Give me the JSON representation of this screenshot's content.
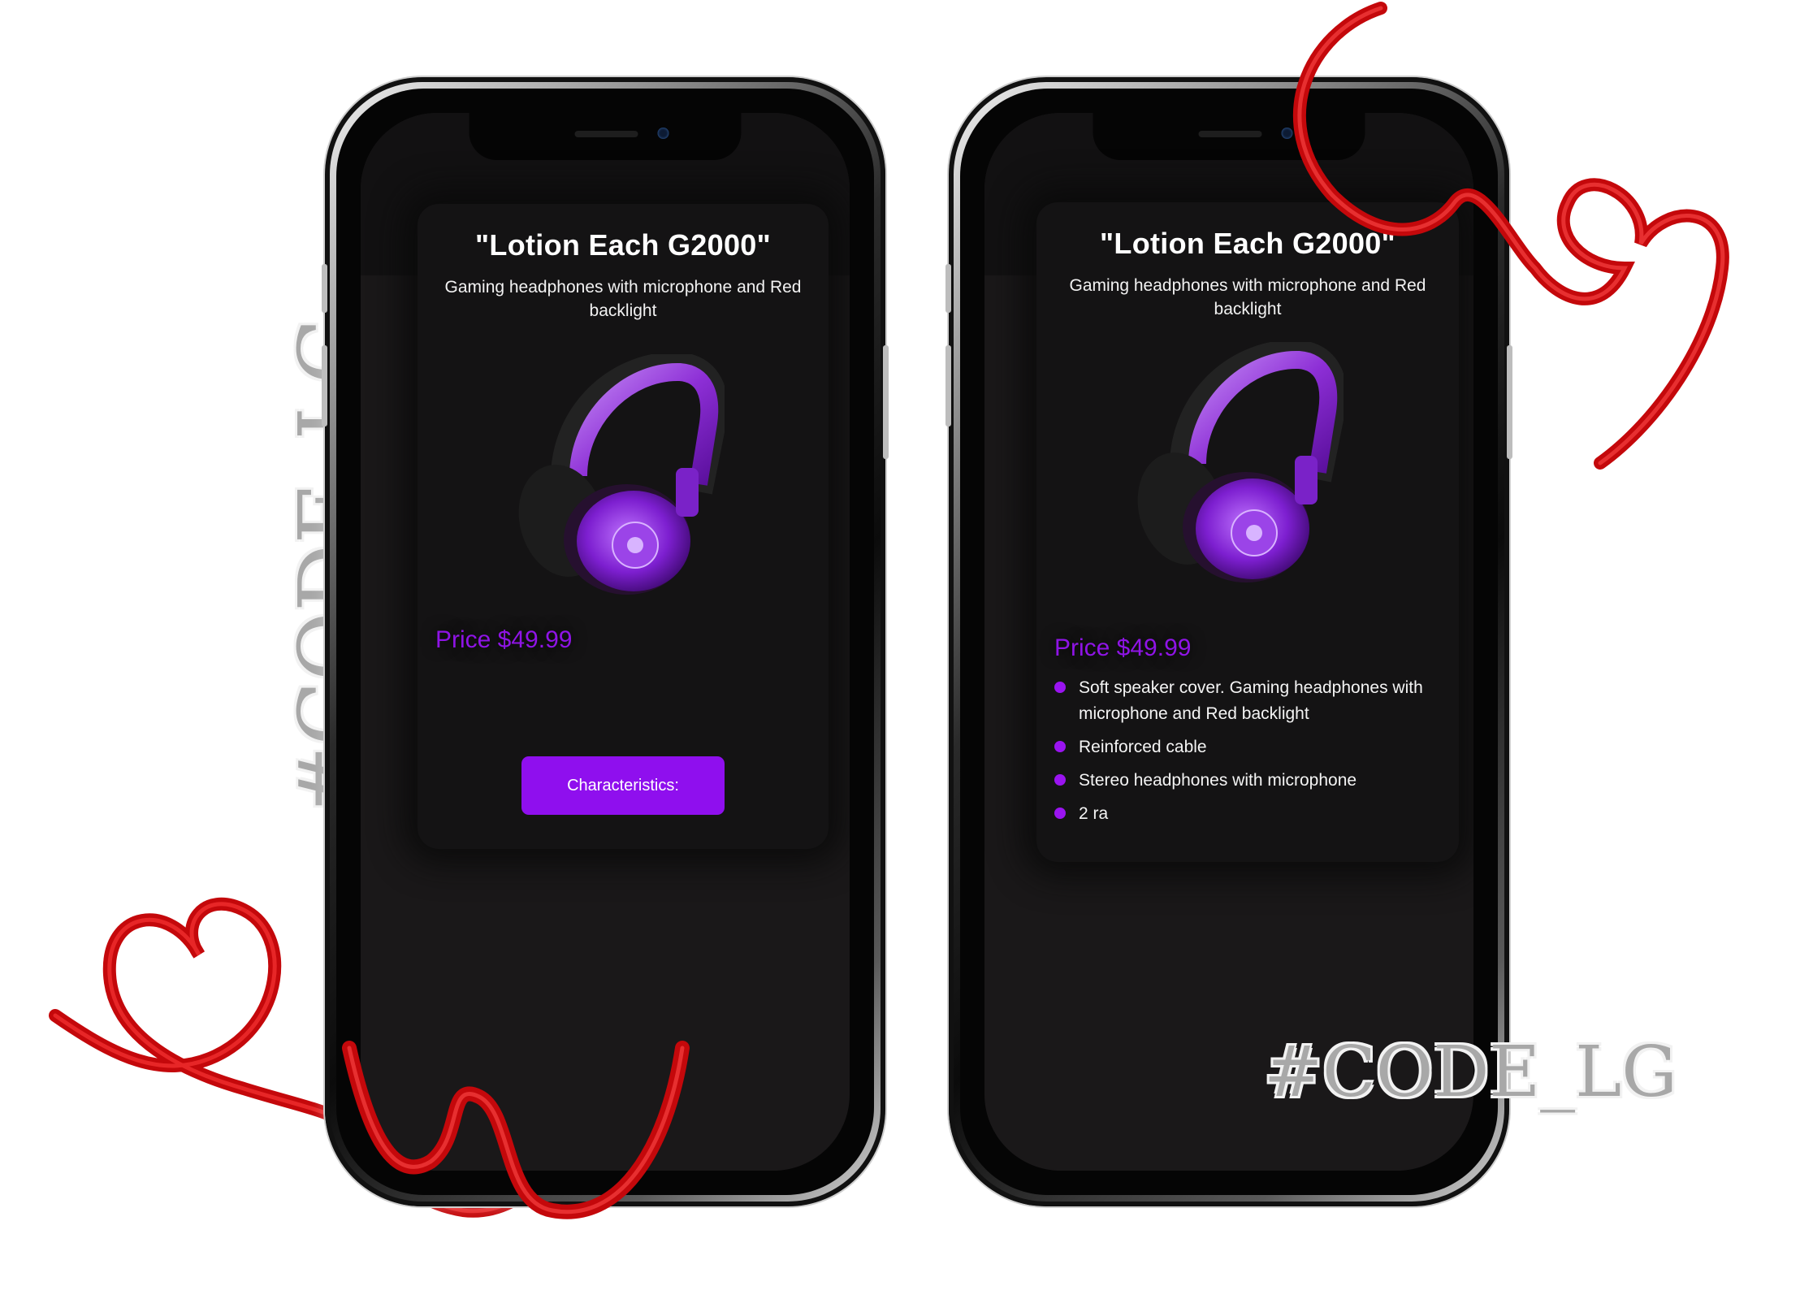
{
  "watermark": {
    "vertical": "#CODE_LG",
    "horizontal": "#CODE_LG"
  },
  "phones": [
    {
      "card": {
        "title": "\"Lotion Each G2000\"",
        "subtitle": "Gaming headphones with microphone and Red backlight",
        "price": "Price $49.99",
        "button_label": "Characteristics:"
      }
    },
    {
      "card": {
        "title": "\"Lotion Each G2000\"",
        "subtitle": "Gaming headphones with microphone and Red backlight",
        "price": "Price $49.99",
        "characteristics": [
          "Soft speaker cover. Gaming headphones with microphone and Red backlight",
          "Reinforced cable",
          "Stereo headphones with microphone",
          "2 ra"
        ]
      }
    }
  ],
  "colors": {
    "accent_purple": "#8f0fee",
    "price_purple": "#8f14e6",
    "ribbon_red": "#d40f12",
    "screen_bg": "#1a1819",
    "card_bg": "#141314"
  },
  "icons": [
    "headphones-image",
    "heart-ribbon-decoration"
  ]
}
